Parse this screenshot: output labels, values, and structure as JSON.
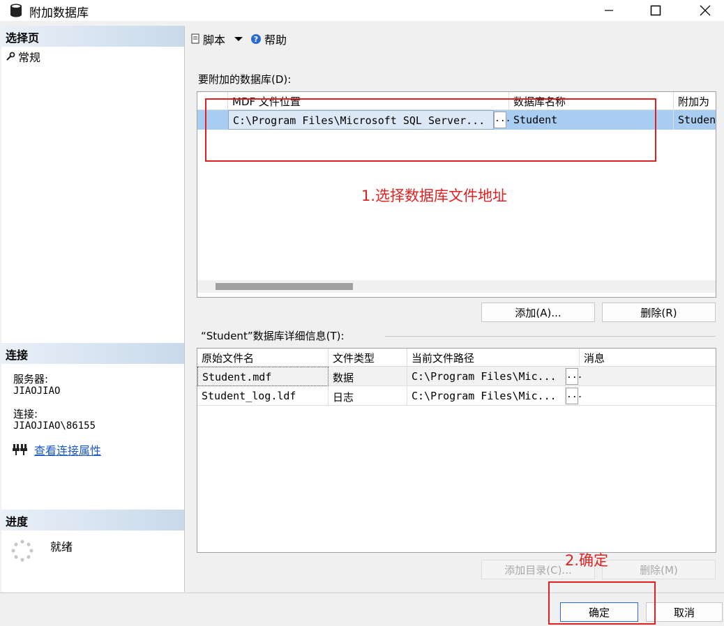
{
  "window": {
    "title": "附加数据库"
  },
  "left": {
    "select_page_header": "选择页",
    "pages": [
      {
        "label": "常规",
        "icon": "wrench-icon"
      }
    ],
    "connection_header": "连接",
    "server_label": "服务器:",
    "server_value": "JIAOJIAO",
    "connection_label": "连接:",
    "connection_value": "JIAOJIAO\\86155",
    "view_props_link": "查看连接属性",
    "progress_header": "进度",
    "progress_status": "就绪"
  },
  "toolbar": {
    "script_label": "脚本",
    "help_label": "帮助"
  },
  "attach": {
    "label": "要附加的数据库(D):",
    "columns": [
      "MDF 文件位置",
      "数据库名称",
      "附加为"
    ],
    "rows": [
      {
        "mdf": "C:\\Program Files\\Microsoft SQL Server...",
        "db_name": "Student",
        "attach_as": "Studen"
      }
    ],
    "add_button": "添加(A)...",
    "remove_button": "删除(R)"
  },
  "details": {
    "label": "“Student”数据库详细信息(T):",
    "columns": [
      "原始文件名",
      "文件类型",
      "当前文件路径",
      "消息"
    ],
    "rows": [
      {
        "name": "Student.mdf",
        "type": "数据",
        "path": "C:\\Program Files\\Mic...",
        "msg": ""
      },
      {
        "name": "Student_log.ldf",
        "type": "日志",
        "path": "C:\\Program Files\\Mic...",
        "msg": ""
      }
    ],
    "add_catalog_button": "添加目录(C)...",
    "remove_button": "删除(M)"
  },
  "footer": {
    "ok_button": "确定",
    "cancel_button": "取消"
  },
  "annotations": {
    "step1": "1.选择数据库文件地址",
    "step2": "2.确定"
  },
  "colors": {
    "annotation": "#e02020",
    "selection": "#a8cdf0",
    "link": "#1a56c8"
  }
}
